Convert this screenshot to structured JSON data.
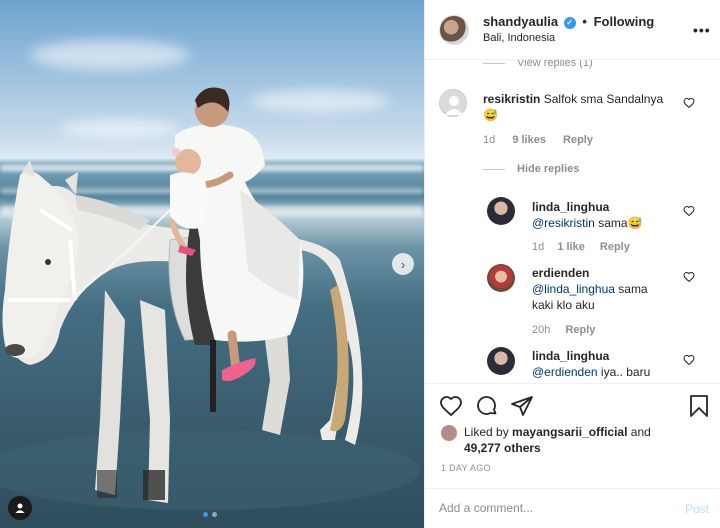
{
  "header": {
    "username": "shandyaulia",
    "verified_mark": "✓",
    "separator": "•",
    "following_label": "Following",
    "location": "Bali, Indonesia",
    "more_icon": "•••"
  },
  "comments": {
    "view_replies_top": "View replies (1)",
    "c1": {
      "username": "resikristin",
      "text": "Salfok sma Sandalnya",
      "emoji": "😅",
      "age": "1d",
      "likes": "9 likes",
      "reply": "Reply"
    },
    "hide_replies": "Hide replies",
    "r1": {
      "username": "linda_linghua",
      "mention": "@resikristin",
      "text": "sama😅",
      "age": "1d",
      "likes": "1 like",
      "reply": "Reply"
    },
    "r2": {
      "username": "erdienden",
      "mention": "@linda_linghua",
      "text": "sama kaki klo aku",
      "age": "20h",
      "reply": "Reply"
    },
    "r3": {
      "username": "linda_linghua",
      "mention": "@erdienden",
      "text": "iya.. baru"
    }
  },
  "actions": {
    "liked_by_prefix": "Liked by",
    "liked_by_user": "mayangsarii_official",
    "and": "and",
    "others": "49,277 others",
    "date": "1 DAY AGO"
  },
  "add_comment": {
    "placeholder": "Add a comment...",
    "post_label": "Post"
  },
  "photo": {
    "next_icon": "›",
    "dots_total": 2,
    "dots_active": 1
  },
  "colors": {
    "accent": "#3897f0",
    "mention": "#00376b",
    "muted": "#8e8e8e",
    "post_disabled": "#b2dffc"
  }
}
